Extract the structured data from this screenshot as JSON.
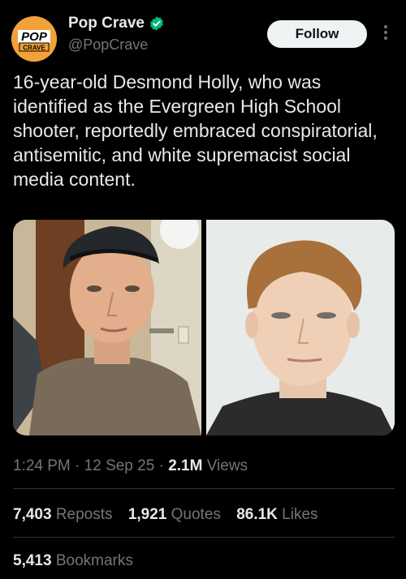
{
  "account": {
    "display_name": "Pop Crave",
    "handle": "@PopCrave",
    "avatar_text_top": "POP",
    "avatar_text_bottom": "CRAVE",
    "avatar_color": "#f2a03a",
    "verified_color": "#00ba7c"
  },
  "follow_label": "Follow",
  "more_icon": "more-vertical-icon",
  "tweet_text": "16-year-old Desmond Holly, who was identified as the Evergreen High School shooter, reportedly embraced conspiratorial, antisemitic, and white supremacist social media content.",
  "media": {
    "photos": [
      "selfie-photo",
      "portrait-photo"
    ]
  },
  "meta": {
    "time": "1:24 PM",
    "date": "12 Sep 25",
    "views_count": "2.1M",
    "views_label": "Views"
  },
  "stats": {
    "reposts_count": "7,403",
    "reposts_label": "Reposts",
    "quotes_count": "1,921",
    "quotes_label": "Quotes",
    "likes_count": "86.1K",
    "likes_label": "Likes",
    "bookmarks_count": "5,413",
    "bookmarks_label": "Bookmarks"
  }
}
